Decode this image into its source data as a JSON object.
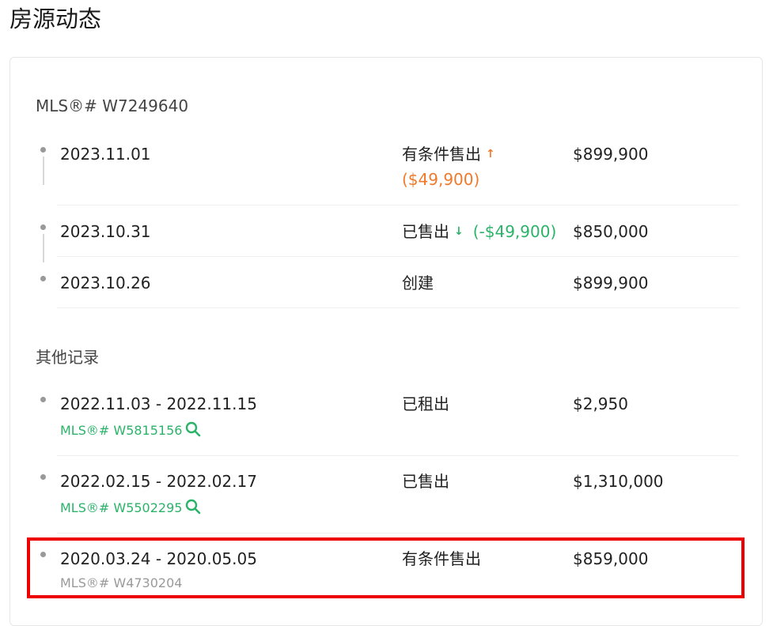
{
  "page": {
    "title": "房源动态"
  },
  "current_listing": {
    "mls_label": "MLS®# W7249640",
    "events": [
      {
        "date": "2023.11.01",
        "status": "有条件售出",
        "change": "($49,900)",
        "direction": "up",
        "price": "$899,900"
      },
      {
        "date": "2023.10.31",
        "status": "已售出",
        "change": "(-$49,900)",
        "direction": "down",
        "price": "$850,000"
      },
      {
        "date": "2023.10.26",
        "status": "创建",
        "price": "$899,900"
      }
    ]
  },
  "other_records": {
    "title": "其他记录",
    "items": [
      {
        "date_range": "2022.11.03 - 2022.11.15",
        "status": "已租出",
        "price": "$2,950",
        "mls": "MLS®# W5815156"
      },
      {
        "date_range": "2022.02.15 - 2022.02.17",
        "status": "已售出",
        "price": "$1,310,000",
        "mls": "MLS®# W5502295"
      },
      {
        "date_range": "2020.03.24 - 2020.05.05",
        "status": "有条件售出",
        "price": "$859,000",
        "mls": "MLS®# W4730204"
      }
    ]
  },
  "colors": {
    "price_up": "#f07a2a",
    "price_down": "#2bb36a",
    "link": "#2bb36a",
    "highlight_border": "#ee0000"
  }
}
